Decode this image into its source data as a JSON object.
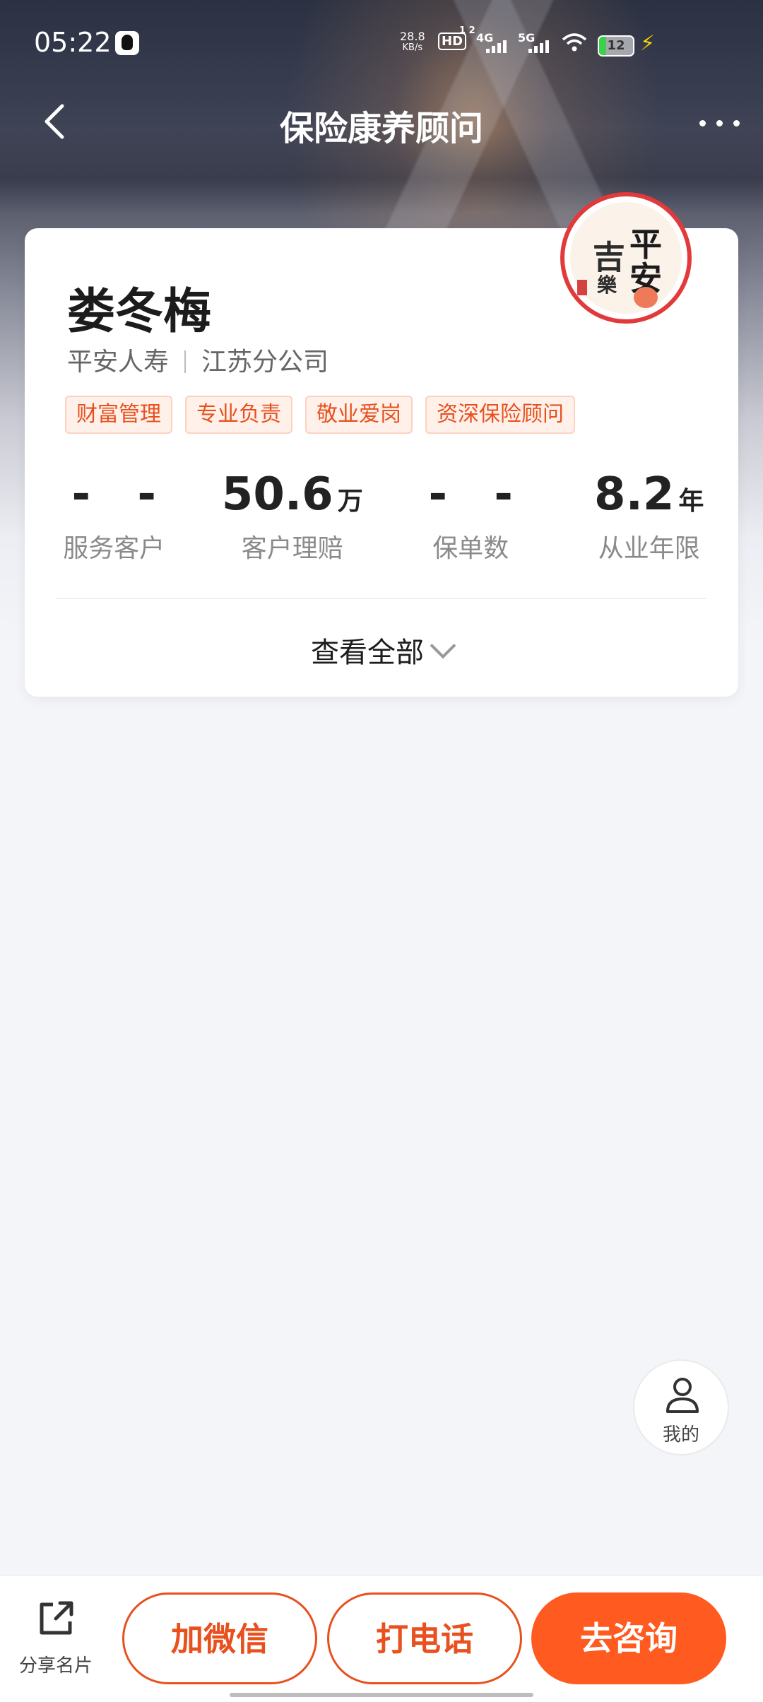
{
  "status_bar": {
    "time": "05:22",
    "net_speed_value": "28.8",
    "net_speed_unit": "KB/s",
    "hd_label": "HD",
    "hd_sub": "1 2",
    "sig1_label": "4G",
    "sig2_label": "5G",
    "battery_level": "12",
    "icons": [
      "qq-icon",
      "wifi-icon",
      "battery-icon",
      "charging-bolt-icon"
    ]
  },
  "nav": {
    "title": "保险康养顾问",
    "back_icon": "chevron-left-icon",
    "more_icon": "more-dots-icon"
  },
  "profile": {
    "name": "娄冬梅",
    "company": "平安人寿",
    "branch": "江苏分公司",
    "avatar_text": [
      "平",
      "安",
      "吉",
      "樂"
    ],
    "tags": [
      "财富管理",
      "专业负责",
      "敬业爱岗",
      "资深保险顾问"
    ],
    "stats": [
      {
        "value": "- -",
        "unit": "",
        "label": "服务客户"
      },
      {
        "value": "50.6",
        "unit": "万",
        "label": "客户理赔"
      },
      {
        "value": "- -",
        "unit": "",
        "label": "保单数"
      },
      {
        "value": "8.2",
        "unit": "年",
        "label": "从业年限"
      }
    ],
    "view_all_label": "查看全部"
  },
  "floating": {
    "me_label": "我的"
  },
  "bottom_bar": {
    "share_label": "分享名片",
    "wechat_label": "加微信",
    "call_label": "打电话",
    "consult_label": "去咨询"
  },
  "colors": {
    "accent": "#ff5a1f",
    "tag_text": "#e8501d",
    "tag_bg": "#fff1ea",
    "avatar_ring": "#e23a3a"
  }
}
